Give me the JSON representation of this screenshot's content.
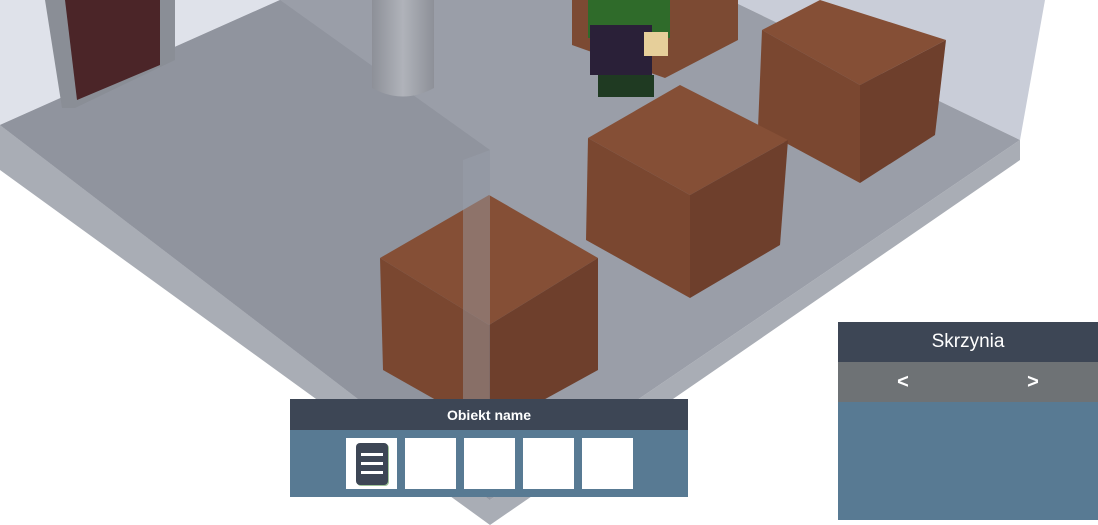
{
  "object_panel": {
    "title": "Obiekt name",
    "slots": [
      {
        "icon": "document-icon",
        "filled": true
      },
      {
        "filled": false
      },
      {
        "filled": false
      },
      {
        "filled": false
      },
      {
        "filled": false
      }
    ]
  },
  "chest_panel": {
    "title": "Skrzynia",
    "prev_label": "<",
    "next_label": ">"
  },
  "colors": {
    "panel_header": "#3d4655",
    "panel_body": "#587a93",
    "nav_bar": "#6e7275",
    "crate": "#7a4a33"
  }
}
